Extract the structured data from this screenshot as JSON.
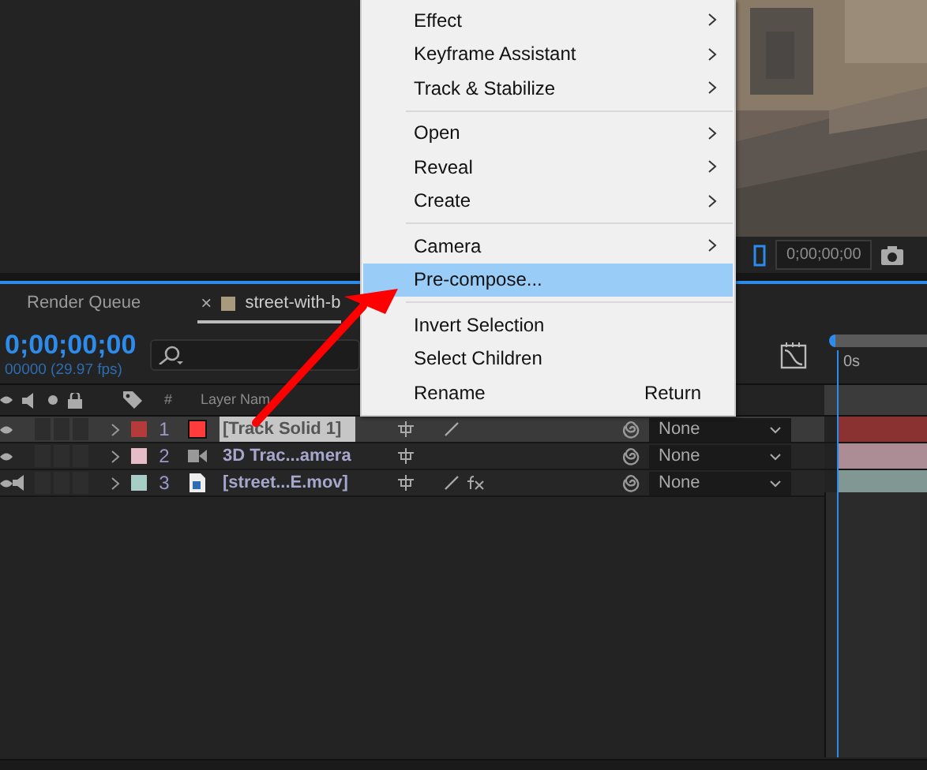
{
  "viewer": {
    "timecode": "0;00;00;00"
  },
  "tabs": [
    {
      "label": "Render Queue",
      "selected": false
    },
    {
      "label": "street-with-b",
      "selected": true,
      "close": "×",
      "color": "#a89a7c"
    }
  ],
  "timeline": {
    "timecode": "0;00;00;00",
    "fps": "00000 (29.97 fps)",
    "ruler_label": "0s",
    "columns": [
      {
        "kind": "hash",
        "label": "#"
      },
      {
        "kind": "name",
        "label": "Layer Nam"
      }
    ],
    "layers": [
      {
        "number": "1",
        "name": "[Track Solid 1]",
        "kind": "solid",
        "color": "#b53a3a",
        "selected": true,
        "audio": false,
        "quality": true,
        "fx": false,
        "parent": "None"
      },
      {
        "number": "2",
        "name": "3D Trac...amera",
        "kind": "camera",
        "color": "#e6bcc8",
        "selected": false,
        "audio": false,
        "quality": false,
        "fx": false,
        "parent": "None"
      },
      {
        "number": "3",
        "name": "[street...E.mov]",
        "kind": "footage",
        "color": "#a8ccc6",
        "selected": false,
        "audio": true,
        "quality": true,
        "fx": true,
        "parent": "None"
      }
    ]
  },
  "context_menu": {
    "items": [
      {
        "kind": "item",
        "label": "Effect",
        "submenu": true,
        "selected": false
      },
      {
        "kind": "item",
        "label": "Keyframe Assistant",
        "submenu": true,
        "selected": false
      },
      {
        "kind": "item",
        "label": "Track & Stabilize",
        "submenu": true,
        "selected": false
      },
      {
        "kind": "separator"
      },
      {
        "kind": "item",
        "label": "Open",
        "submenu": true,
        "selected": false
      },
      {
        "kind": "item",
        "label": "Reveal",
        "submenu": true,
        "selected": false
      },
      {
        "kind": "item",
        "label": "Create",
        "submenu": true,
        "selected": false
      },
      {
        "kind": "separator"
      },
      {
        "kind": "item",
        "label": "Camera",
        "submenu": true,
        "selected": false
      },
      {
        "kind": "item",
        "label": "Pre-compose...",
        "submenu": false,
        "selected": true
      },
      {
        "kind": "separator"
      },
      {
        "kind": "item",
        "label": "Invert Selection",
        "submenu": false,
        "selected": false
      },
      {
        "kind": "item",
        "label": "Select Children",
        "submenu": false,
        "selected": false
      },
      {
        "kind": "item",
        "label": "Rename",
        "submenu": false,
        "selected": false,
        "shortcut": "Return"
      }
    ]
  }
}
